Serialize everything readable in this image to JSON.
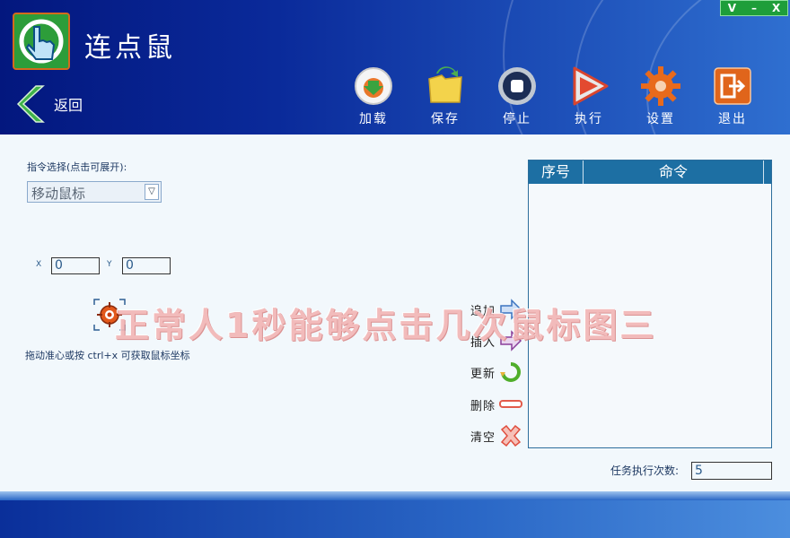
{
  "window": {
    "title": "连点鼠",
    "controls": [
      "V",
      "–",
      "X"
    ]
  },
  "nav": {
    "back_label": "返回"
  },
  "toolbar": {
    "buttons": [
      {
        "label": "加载",
        "icon": "load-icon"
      },
      {
        "label": "保存",
        "icon": "save-folder-icon"
      },
      {
        "label": "停止",
        "icon": "stop-icon"
      },
      {
        "label": "执行",
        "icon": "play-icon"
      },
      {
        "label": "设置",
        "icon": "gear-icon"
      },
      {
        "label": "退出",
        "icon": "exit-icon"
      }
    ]
  },
  "command": {
    "select_label": "指令选择(点击可展开):",
    "selected": "移动鼠标"
  },
  "coords": {
    "x_label": "X",
    "x_value": "0",
    "y_label": "Y",
    "y_value": "0"
  },
  "hint": "拖动准心或按 ctrl+x 可获取鼠标坐标",
  "list": {
    "columns": [
      "序号",
      "命令"
    ],
    "rows": []
  },
  "actions": [
    {
      "label": "追加",
      "icon": "append-arrow-icon"
    },
    {
      "label": "插入",
      "icon": "insert-arrow-icon"
    },
    {
      "label": "更新",
      "icon": "refresh-icon"
    },
    {
      "label": "删除",
      "icon": "minus-icon"
    },
    {
      "label": "清空",
      "icon": "clear-x-icon"
    }
  ],
  "task": {
    "label": "任务执行次数:",
    "count": "5"
  },
  "watermark": "正常人1秒能够点击几次鼠标图三",
  "colors": {
    "header_dark": "#03177e",
    "header_light": "#2f6fd0",
    "body_bg": "#f2f8fc",
    "list_header": "#1d6fa3",
    "window_controls": "#1e9e3a"
  }
}
